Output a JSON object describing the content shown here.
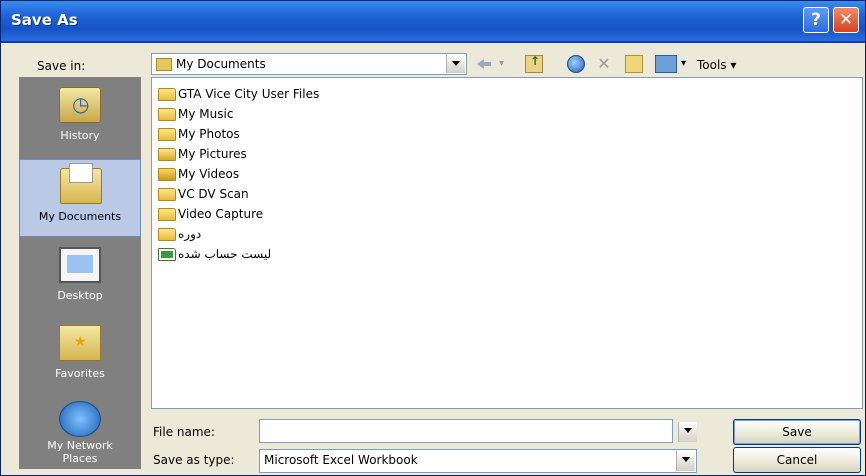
{
  "window": {
    "title": "Save As"
  },
  "toolbar": {
    "save_in_label": "Save in:",
    "save_in_value": "My Documents",
    "tools_label": "Tools"
  },
  "places": [
    {
      "label": "History",
      "icon": "history-icon"
    },
    {
      "label": "My Documents",
      "icon": "my-documents-icon",
      "active": true
    },
    {
      "label": "Desktop",
      "icon": "desktop-icon"
    },
    {
      "label": "Favorites",
      "icon": "favorites-icon"
    },
    {
      "label": "My Network Places",
      "icon": "network-places-icon"
    }
  ],
  "files": [
    {
      "name": "GTA Vice City User Files",
      "icon": "folder-icon"
    },
    {
      "name": "My Music",
      "icon": "music-folder-icon"
    },
    {
      "name": "My Photos",
      "icon": "folder-icon"
    },
    {
      "name": "My Pictures",
      "icon": "pictures-folder-icon"
    },
    {
      "name": "My Videos",
      "icon": "videos-folder-icon"
    },
    {
      "name": "VC DV Scan",
      "icon": "folder-icon"
    },
    {
      "name": "Video Capture",
      "icon": "folder-icon"
    },
    {
      "name": "دوره",
      "icon": "folder-icon"
    },
    {
      "name": "لیست حساب شده",
      "icon": "excel-file-icon"
    }
  ],
  "form": {
    "file_name_label": "File name:",
    "file_name_value": "",
    "save_as_type_label": "Save as type:",
    "save_as_type_value": "Microsoft Excel Workbook"
  },
  "buttons": {
    "save": "Save",
    "cancel": "Cancel",
    "help": "?",
    "close": "✕"
  }
}
